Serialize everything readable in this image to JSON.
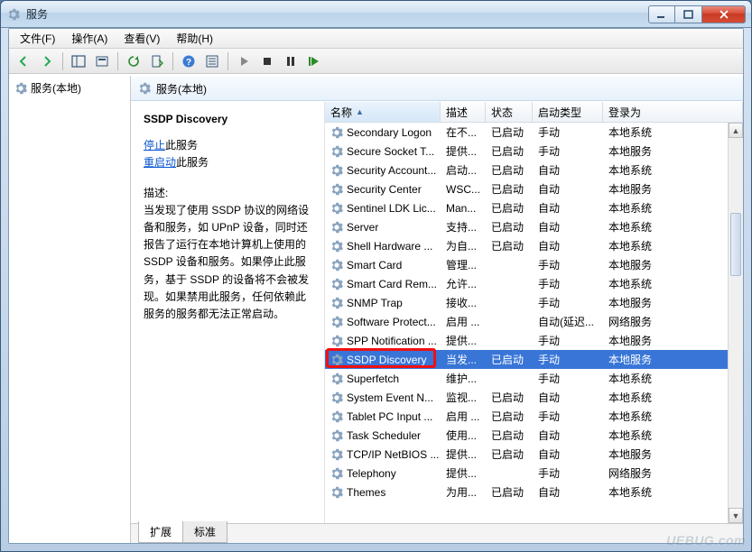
{
  "window": {
    "title": "服务",
    "watermark": "UEBUG.com"
  },
  "menubar": [
    "文件(F)",
    "操作(A)",
    "查看(V)",
    "帮助(H)"
  ],
  "toolbar_icons": [
    "back",
    "forward",
    "sep",
    "panes",
    "show-hide",
    "sep",
    "refresh",
    "export",
    "sep",
    "help",
    "props",
    "sep",
    "play",
    "stop",
    "pause",
    "restart"
  ],
  "tree": {
    "root_label": "服务(本地)"
  },
  "panel": {
    "header": "服务(本地)"
  },
  "detail": {
    "service_name": "SSDP Discovery",
    "stop_link": "停止",
    "stop_suffix": "此服务",
    "restart_link": "重启动",
    "restart_suffix": "此服务",
    "desc_label": "描述:",
    "desc_text": "当发现了使用 SSDP 协议的网络设备和服务，如 UPnP 设备，同时还报告了运行在本地计算机上使用的 SSDP 设备和服务。如果停止此服务，基于 SSDP 的设备将不会被发现。如果禁用此服务，任何依赖此服务的服务都无法正常启动。"
  },
  "columns": [
    "名称",
    "描述",
    "状态",
    "启动类型",
    "登录为"
  ],
  "tabs": [
    "扩展",
    "标准"
  ],
  "active_tab": 0,
  "selected_service": "SSDP Discovery",
  "rows": [
    {
      "name": "Secondary Logon",
      "desc": "在不...",
      "status": "已启动",
      "startup": "手动",
      "logon": "本地系统"
    },
    {
      "name": "Secure Socket T...",
      "desc": "提供...",
      "status": "已启动",
      "startup": "手动",
      "logon": "本地服务"
    },
    {
      "name": "Security Account...",
      "desc": "启动...",
      "status": "已启动",
      "startup": "自动",
      "logon": "本地系统"
    },
    {
      "name": "Security Center",
      "desc": "WSC...",
      "status": "已启动",
      "startup": "自动",
      "logon": "本地服务"
    },
    {
      "name": "Sentinel LDK Lic...",
      "desc": "Man...",
      "status": "已启动",
      "startup": "自动",
      "logon": "本地系统"
    },
    {
      "name": "Server",
      "desc": "支持...",
      "status": "已启动",
      "startup": "自动",
      "logon": "本地系统"
    },
    {
      "name": "Shell Hardware ...",
      "desc": "为自...",
      "status": "已启动",
      "startup": "自动",
      "logon": "本地系统"
    },
    {
      "name": "Smart Card",
      "desc": "管理...",
      "status": "",
      "startup": "手动",
      "logon": "本地服务"
    },
    {
      "name": "Smart Card Rem...",
      "desc": "允许...",
      "status": "",
      "startup": "手动",
      "logon": "本地系统"
    },
    {
      "name": "SNMP Trap",
      "desc": "接收...",
      "status": "",
      "startup": "手动",
      "logon": "本地服务"
    },
    {
      "name": "Software Protect...",
      "desc": "启用 ...",
      "status": "",
      "startup": "自动(延迟...",
      "logon": "网络服务"
    },
    {
      "name": "SPP Notification ...",
      "desc": "提供...",
      "status": "",
      "startup": "手动",
      "logon": "本地服务"
    },
    {
      "name": "SSDP Discovery",
      "desc": "当发...",
      "status": "已启动",
      "startup": "手动",
      "logon": "本地服务"
    },
    {
      "name": "Superfetch",
      "desc": "维护...",
      "status": "",
      "startup": "手动",
      "logon": "本地系统"
    },
    {
      "name": "System Event N...",
      "desc": "监视...",
      "status": "已启动",
      "startup": "自动",
      "logon": "本地系统"
    },
    {
      "name": "Tablet PC Input ...",
      "desc": "启用 ...",
      "status": "已启动",
      "startup": "手动",
      "logon": "本地系统"
    },
    {
      "name": "Task Scheduler",
      "desc": "使用...",
      "status": "已启动",
      "startup": "自动",
      "logon": "本地系统"
    },
    {
      "name": "TCP/IP NetBIOS ...",
      "desc": "提供...",
      "status": "已启动",
      "startup": "自动",
      "logon": "本地服务"
    },
    {
      "name": "Telephony",
      "desc": "提供...",
      "status": "",
      "startup": "手动",
      "logon": "网络服务"
    },
    {
      "name": "Themes",
      "desc": "为用...",
      "status": "已启动",
      "startup": "自动",
      "logon": "本地系统"
    }
  ]
}
